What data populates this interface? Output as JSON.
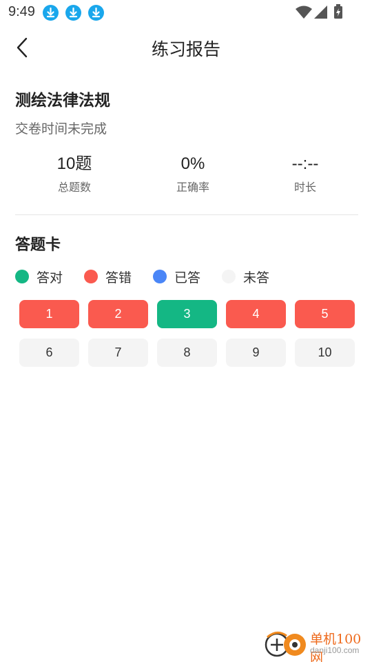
{
  "status_bar": {
    "time": "9:49",
    "icons": [
      "download-icon",
      "download-icon",
      "download-icon",
      "wifi-icon",
      "signal-icon",
      "battery-charging-icon"
    ]
  },
  "header": {
    "title": "练习报告",
    "back_icon": "chevron-left-icon"
  },
  "exam": {
    "name": "测绘法律法规",
    "status": "交卷时间未完成"
  },
  "stats": [
    {
      "value": "10题",
      "label": "总题数"
    },
    {
      "value": "0%",
      "label": "正确率"
    },
    {
      "value": "--:--",
      "label": "时长"
    }
  ],
  "answer_card": {
    "title": "答题卡",
    "legend": [
      {
        "label": "答对",
        "color": "#14b784"
      },
      {
        "label": "答错",
        "color": "#fa5a4f"
      },
      {
        "label": "已答",
        "color": "#4a86f7"
      },
      {
        "label": "未答",
        "color": "#f4f4f4"
      }
    ],
    "questions": [
      {
        "number": "1",
        "state": "wrong"
      },
      {
        "number": "2",
        "state": "wrong"
      },
      {
        "number": "3",
        "state": "right"
      },
      {
        "number": "4",
        "state": "wrong"
      },
      {
        "number": "5",
        "state": "wrong"
      },
      {
        "number": "6",
        "state": "unanswered"
      },
      {
        "number": "7",
        "state": "unanswered"
      },
      {
        "number": "8",
        "state": "unanswered"
      },
      {
        "number": "9",
        "state": "unanswered"
      },
      {
        "number": "10",
        "state": "unanswered"
      }
    ]
  },
  "watermark": {
    "text": "单机100网",
    "url": "danji100.com"
  }
}
